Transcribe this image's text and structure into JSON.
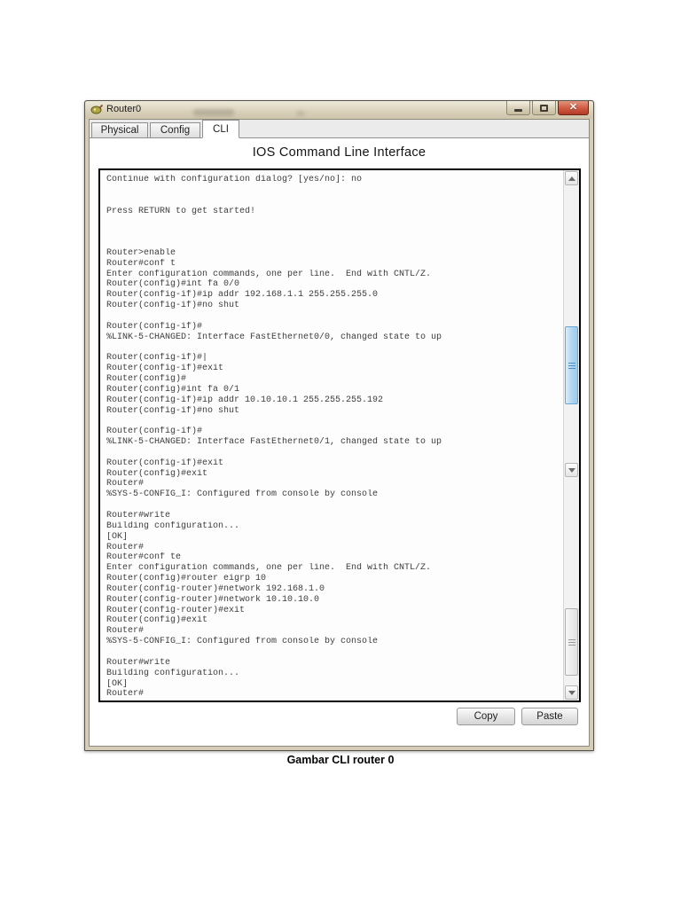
{
  "window": {
    "title": "Router0"
  },
  "tabs": [
    {
      "label": "Physical",
      "active": false
    },
    {
      "label": "Config",
      "active": false
    },
    {
      "label": "CLI",
      "active": true
    }
  ],
  "cli": {
    "heading": "IOS Command Line Interface",
    "terminal_lines": [
      "Continue with configuration dialog? [yes/no]: no",
      "",
      "",
      "Press RETURN to get started!",
      "",
      "",
      "",
      "Router>enable",
      "Router#conf t",
      "Enter configuration commands, one per line.  End with CNTL/Z.",
      "Router(config)#int fa 0/0",
      "Router(config-if)#ip addr 192.168.1.1 255.255.255.0",
      "Router(config-if)#no shut",
      "",
      "Router(config-if)#",
      "%LINK-5-CHANGED: Interface FastEthernet0/0, changed state to up",
      "",
      "Router(config-if)#|",
      "Router(config-if)#exit",
      "Router(config)#",
      "Router(config)#int fa 0/1",
      "Router(config-if)#ip addr 10.10.10.1 255.255.255.192",
      "Router(config-if)#no shut",
      "",
      "Router(config-if)#",
      "%LINK-5-CHANGED: Interface FastEthernet0/1, changed state to up",
      "",
      "Router(config-if)#exit",
      "Router(config)#exit",
      "Router#",
      "%SYS-5-CONFIG_I: Configured from console by console",
      "",
      "Router#write",
      "Building configuration...",
      "[OK]",
      "Router#",
      "Router#conf te",
      "Enter configuration commands, one per line.  End with CNTL/Z.",
      "Router(config)#router eigrp 10",
      "Router(config-router)#network 192.168.1.0",
      "Router(config-router)#network 10.10.10.0",
      "Router(config-router)#exit",
      "Router(config)#exit",
      "Router#",
      "%SYS-5-CONFIG_I: Configured from console by console",
      "",
      "Router#write",
      "Building configuration...",
      "[OK]",
      "Router#"
    ],
    "buttons": {
      "copy": "Copy",
      "paste": "Paste"
    }
  },
  "caption": "Gambar CLI router 0",
  "colors": {
    "titlebar_beige": "#d9d0ba",
    "close_red": "#c74634",
    "scroll_thumb_blue": "#aed5f0",
    "terminal_text": "#3d3d3d"
  }
}
